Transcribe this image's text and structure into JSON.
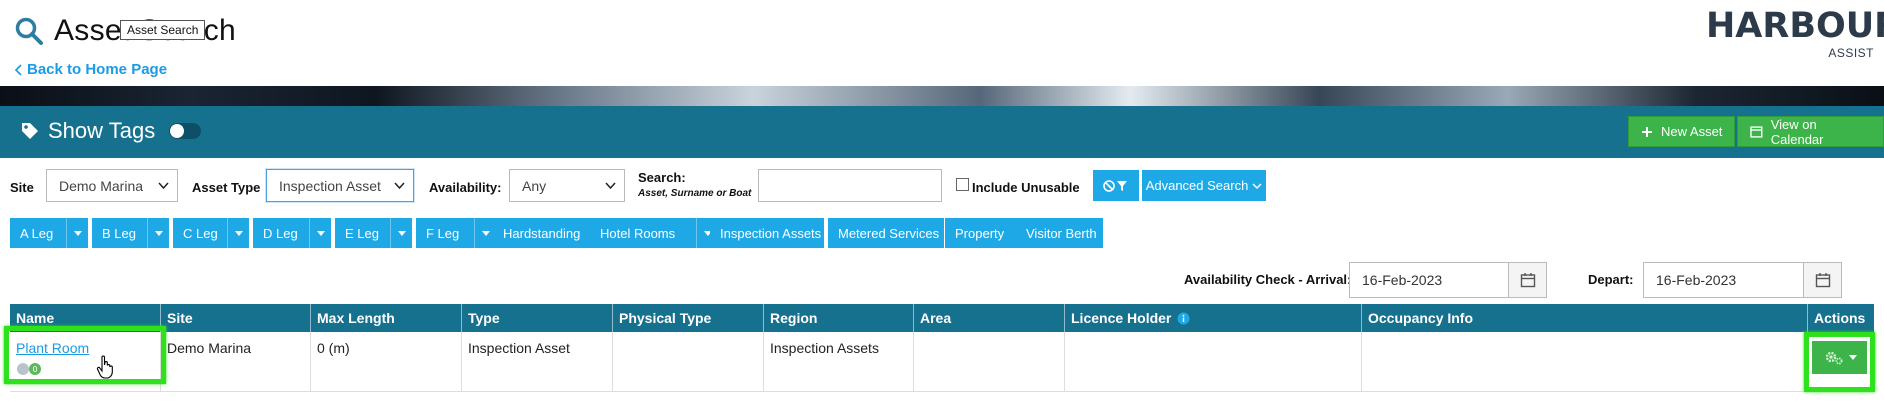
{
  "header": {
    "title": "Asset Search",
    "tooltip": "Asset Search",
    "back_link": "Back to Home Page",
    "logo_main": "HARBOUR",
    "logo_sub": "ASSIST"
  },
  "toolbar": {
    "show_tags_label": "Show Tags",
    "new_asset_label": "New Asset",
    "view_calendar_label": "View on Calendar"
  },
  "filters": {
    "site_label": "Site",
    "site_value": "Demo Marina",
    "asset_type_label": "Asset Type",
    "asset_type_value": "Inspection Asset",
    "availability_label": "Availability:",
    "availability_value": "Any",
    "search_label": "Search:",
    "search_hint": "Asset, Surname or Boat",
    "search_value": "",
    "include_unusable_label": "Include Unusable",
    "advanced_search_label": "Advanced Search"
  },
  "chips": [
    {
      "label": "A Leg",
      "caret": true
    },
    {
      "label": "B Leg",
      "caret": true
    },
    {
      "label": "C Leg",
      "caret": true
    },
    {
      "label": "D Leg",
      "caret": true
    },
    {
      "label": "E Leg",
      "caret": true
    },
    {
      "label": "F Leg",
      "caret": true
    },
    {
      "label": "Hardstanding",
      "caret": false
    },
    {
      "label": "Hotel Rooms",
      "caret": true
    },
    {
      "label": "Inspection Assets",
      "caret": false
    },
    {
      "label": "Metered Services",
      "caret": false
    },
    {
      "label": "Property",
      "caret": false
    },
    {
      "label": "Visitor Berth",
      "caret": false
    }
  ],
  "availability": {
    "arrival_label": "Availability Check - Arrival:",
    "arrival_value": "16-Feb-2023",
    "depart_label": "Depart:",
    "depart_value": "16-Feb-2023"
  },
  "table": {
    "columns": [
      "Name",
      "Site",
      "Max Length",
      "Type",
      "Physical Type",
      "Region",
      "Area",
      "Licence Holder",
      "Occupancy Info",
      "Actions"
    ],
    "rows": [
      {
        "name": "Plant Room",
        "site": "Demo Marina",
        "max_length": "0 (m)",
        "type": "Inspection Asset",
        "physical_type": "",
        "region": "Inspection Assets",
        "area": "",
        "licence_holder": "",
        "occupancy_info": ""
      }
    ]
  },
  "colors": {
    "band": "#16718f",
    "accent_blue": "#1ea9e6",
    "action_green": "#3cb44a",
    "highlight": "#2fe01c"
  }
}
